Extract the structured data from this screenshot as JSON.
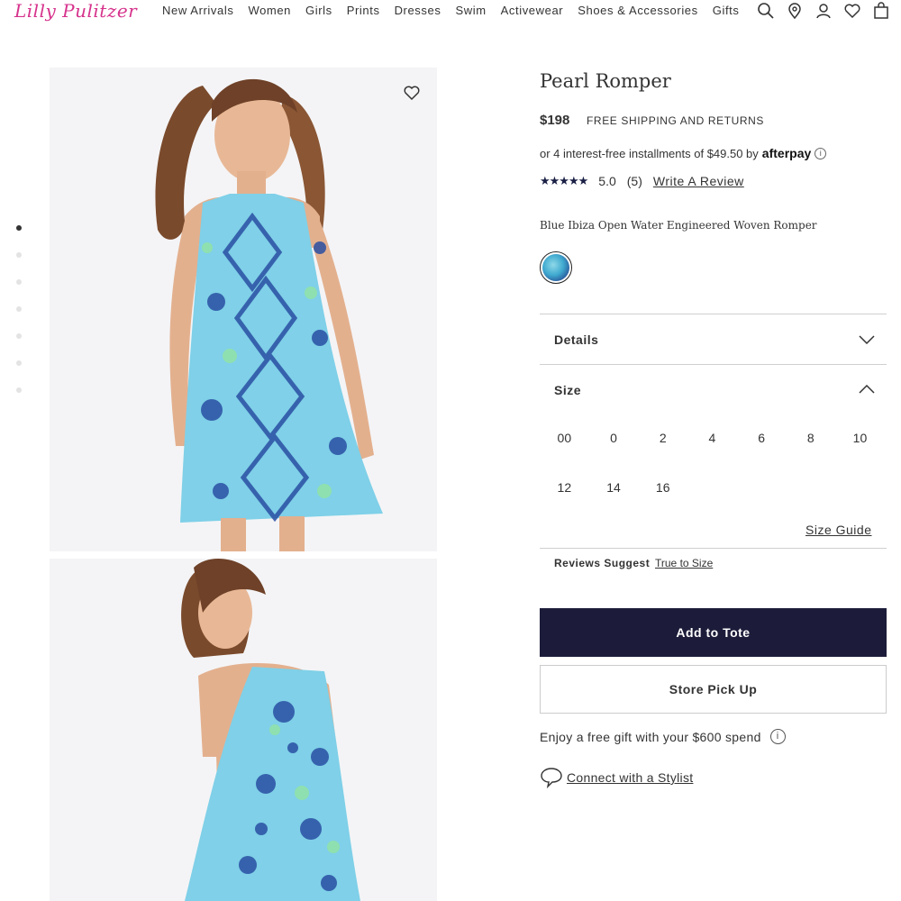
{
  "header": {
    "logo": "Lilly Pulitzer",
    "nav": [
      "New Arrivals",
      "Women",
      "Girls",
      "Prints",
      "Dresses",
      "Swim",
      "Activewear",
      "Shoes & Accessories",
      "Gifts"
    ],
    "icons": [
      "search-icon",
      "location-pin-icon",
      "account-icon",
      "heart-icon",
      "bag-icon"
    ]
  },
  "gallery": {
    "dot_count": 7,
    "active_dot": 0,
    "colors": {
      "print_light": "#7fd0e8",
      "print_dark": "#2a4fa3",
      "print_green": "#8fe0b0"
    }
  },
  "product": {
    "title": "Pearl Romper",
    "price": "$198",
    "shipping": "FREE SHIPPING AND RETURNS",
    "afterpay_text": "or 4 interest-free installments of $49.50 by",
    "afterpay_brand": "afterpay",
    "stars": "★★★★★",
    "rating": "5.0",
    "review_count": "(5)",
    "write_review": "Write A Review",
    "variant": "Blue Ibiza Open Water Engineered Woven Romper"
  },
  "accordion": {
    "details_label": "Details",
    "size_label": "Size",
    "sizes": [
      "00",
      "0",
      "2",
      "4",
      "6",
      "8",
      "10",
      "12",
      "14",
      "16"
    ],
    "size_guide": "Size Guide",
    "reviews_suggest_label": "Reviews Suggest",
    "reviews_suggest_value": "True to Size"
  },
  "actions": {
    "add_to_tote": "Add to Tote",
    "store_pickup": "Store Pick Up",
    "gift_text": "Enjoy a free gift with your $600 spend",
    "stylist_link": "Connect with a Stylist"
  },
  "colors": {
    "primary_button": "#1c1c3a",
    "logo_pink": "#d6338c"
  }
}
